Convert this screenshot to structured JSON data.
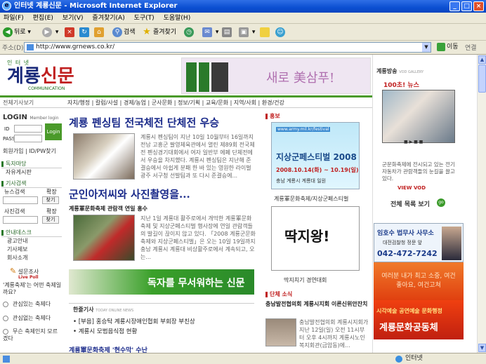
{
  "window": {
    "title": "인터넷 계룡신문 - Microsoft Internet Explorer"
  },
  "menu": [
    "파일(F)",
    "편집(E)",
    "보기(V)",
    "즐겨찾기(A)",
    "도구(T)",
    "도움말(H)"
  ],
  "toolbar": {
    "back": "뒤로",
    "search": "검색",
    "favorites": "즐겨찾기"
  },
  "address": {
    "label": "주소(D)",
    "url": "http://www.grnews.co.kr/",
    "go": "이동",
    "links": "연결"
  },
  "status": {
    "zone": "인터넷"
  },
  "site": {
    "logo_small": "인 터 넷",
    "logo_big_a": "계룡",
    "logo_big_b": "신문",
    "logo_sub": "COMMUNICATION",
    "banner_text": "새로 美삼푸!",
    "nav_label": "전체기사보기",
    "nav_items": "자치/행정 | 칼럼/사설 | 경제/농업 | 군사문화 | 정보/기획 | 교육/문화 | 지역/사회 | 환경/건강"
  },
  "left": {
    "login_title": "LOGIN",
    "login_sub": "Member login",
    "id_label": "ID",
    "pass_label": "PASS",
    "login_btn": "Login",
    "join": "회원가입 | ID/PW찾기",
    "board_head": "독자마당",
    "board_item": "자유게시판",
    "search_head": "기사검색",
    "news_search": "뉴스검색",
    "photo_search": "사진검색",
    "expand": "확장",
    "go": "찾기",
    "info_head": "안내데스크",
    "info_items": [
      "광고안내",
      "기사제보",
      "회사소개"
    ],
    "poll_title": "설문조사",
    "poll_live": "Live Poll",
    "poll_question": "'계룡축제'는 어떤 축제일까요?",
    "poll_options": [
      "관심있는 축제다",
      "관심없는 축제다",
      "무슨 축제인지 모르겠다"
    ]
  },
  "center": {
    "headline1": "계룡 펜싱팀 전국체전 단체전 우승",
    "body1": "계룡시 펜싱팀이 지난 10일 10월부터 16일까지 전남 고흥군 팔영체육관에서 열린 제89회 전국체전 펜싱경기대회에서 여자 일반부 에페 단체전에서 우승을 차지했다. 계룡시 펜싱팀은 지난해 준결승에서 아쉽게 분패 한 바 있는 영원한 라이벌 광주 서구청 선발팀과 또 다시 준결승에...",
    "headline2": "군인아저씨와 사진촬영을...",
    "sub2": "계룡軍문화축제 관람객 연일 홍수",
    "body2": "지난 1일 계룡대 활주로에서 개막한 계룡軍문화축제 및 지상군페스티벌 행사장에 연일 관람객들의 발길이 끊이지 않고 있다. 「2008 계룡군문화축제와 지상군페스티벌」은 오는 10일 19일까지 충남 계룡시 계룡대 비상활주로에서 계속되고, 오는...",
    "green_banner": "독자를 무서워하는 신문",
    "today_head": "한줄기사",
    "today_en": "TODAY ONLINE NEWS",
    "today_items": [
      "[부음] 홍승탁 계룡시장애인협회 부회장 부친상",
      "계룡시 모범음식점 현황"
    ],
    "bottom_head": "계룡軍문화축제 '현수막' 수난"
  },
  "promo": {
    "head": "홍보",
    "festival_url": "www.army.mil.kr/festival",
    "festival_title": "지상군페스티벌 2008",
    "festival_date": "2008.10.14(화) ~ 10.19(일)",
    "festival_place": "충남 계룡시 계룡대 일원",
    "caption1": "계룡軍문화축제/지상군페스티벌",
    "cartoon_text": "딱지왕!",
    "caption2": "딱지치기 경연대회",
    "council_head": "단체 소식",
    "council_title": "충남발전협의회 계룡시지회 이른신위안잔치",
    "council_body": "충남발전협의회 계룡시지회가 지난 12일(일) 오전 11시부터 오후 4시까지 계룡시노인복지회관(금암동)에..."
  },
  "right": {
    "head": "계룡방송",
    "head_en": "VOD GALLERY",
    "news100": "100초! 뉴스",
    "vod_caption": "군문화축제에 전시되고 있는 전기자동차가 관람객들의 눈길을 끌고 있다.",
    "view_vod": "VIEW VOD",
    "all_list": "전체 목록 보기",
    "ad1_title": "임호수 법무사 사무소",
    "ad1_addr": "대전검찰청 정문 앞",
    "ad1_phone": "042-472-7242",
    "ad2_text": "여러분 내가 최고 소중, 여건좋아요, 여건고쳐",
    "ad3_title": "시각예술 공연예술 문화행정",
    "ad3_org": "계룡문화공동체"
  }
}
